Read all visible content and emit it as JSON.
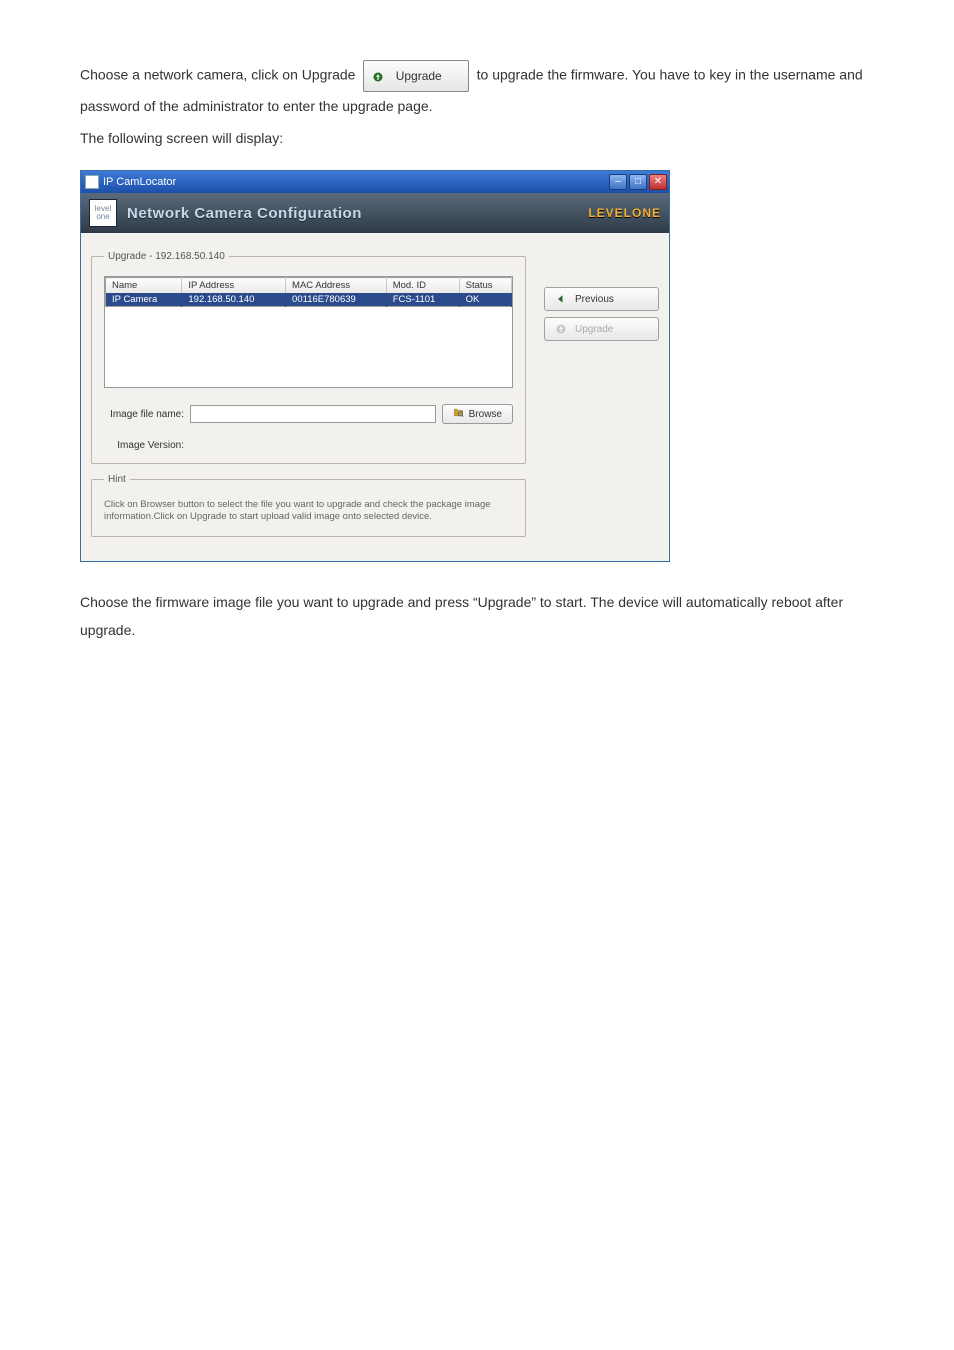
{
  "para1_a": "Choose a network camera, click on Upgrade ",
  "inline_button_label": "Upgrade",
  "para1_b": " to upgrade the firmware. You have to key in the username and password of the administrator to enter the upgrade page.",
  "para2": "The following screen will display:",
  "window": {
    "title": "IP CamLocator",
    "banner_title": "Network Camera Configuration",
    "brand": "LEVELONE",
    "fieldset_legend": "Upgrade - 192.168.50.140",
    "columns": {
      "c1": "Name",
      "c2": "IP Address",
      "c3": "MAC Address",
      "c4": "Mod. ID",
      "c5": "Status"
    },
    "row": {
      "c1": "IP Camera",
      "c2": "192.168.50.140",
      "c3": "00116E780639",
      "c4": "FCS-1101",
      "c5": "OK"
    },
    "image_file_label": "Image file name:",
    "image_version_label": "Image Version:",
    "browse_label": "Browse",
    "previous_label": "Previous",
    "upgrade_label": "Upgrade",
    "hint_legend": "Hint",
    "hint_text": "Click on Browser button to select the file you want to upgrade and check the package image information.Click on Upgrade to start upload valid image onto selected device."
  },
  "para3": "Choose the firmware image file you want to upgrade and press “Upgrade” to start. The device will automatically reboot after upgrade."
}
